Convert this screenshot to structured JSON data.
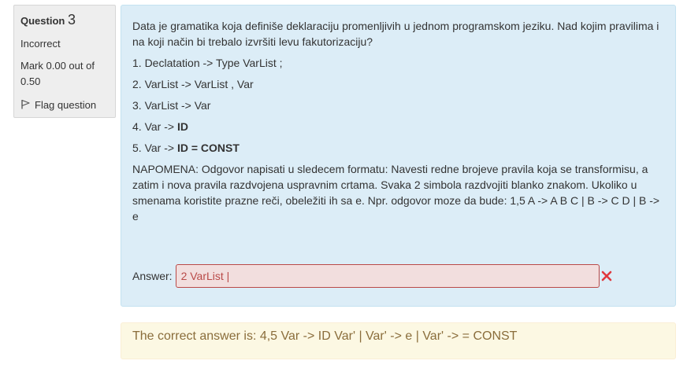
{
  "info": {
    "question_label": "Question",
    "question_number": "3",
    "state": "Incorrect",
    "grade": "Mark 0.00 out of 0.50",
    "flag_label": "Flag question"
  },
  "question": {
    "text": "Data  je gramatika koja definiše deklaraciju promenljivih u jednom programskom jeziku. Nad kojim pravilima i na koji način bi trebalo izvršiti levu fakutorizaciju?",
    "rules": [
      {
        "plain": "1. Declatation -> Type VarList ;",
        "bold": ""
      },
      {
        "plain": "2. VarList -> VarList  , Var",
        "bold": ""
      },
      {
        "plain": "3. VarList -> Var",
        "bold": ""
      },
      {
        "plain": "4. Var -> ",
        "bold": "ID"
      },
      {
        "plain": "5. Var -> ",
        "bold": "ID = CONST"
      }
    ],
    "note": "NAPOMENA: Odgovor napisati u sledecem formatu: Navesti redne brojeve pravila koja se transformisu, a zatim i nova pravila razdvojena uspravnim crtama. Svaka 2 simbola razdvojiti blanko znakom. Ukoliko u smenama koristite prazne reči, obeležiti ih sa e. Npr. odgovor moze da bude: 1,5 A -> A B C | B -> C D | B -> e"
  },
  "answer": {
    "label": "Answer:",
    "value": "2 VarList |"
  },
  "feedback": {
    "correct_answer": "The correct answer is: 4,5 Var -> ID Var' | Var' -> e | Var' -> = CONST"
  },
  "colors": {
    "formulation_bg": "#dcedf7",
    "incorrect": "#b94a48",
    "incorrect_bg": "#f2dede",
    "outcome_bg": "#fcf8e3",
    "outcome_text": "#8a6d3b",
    "x_icon": "#e0393e"
  }
}
